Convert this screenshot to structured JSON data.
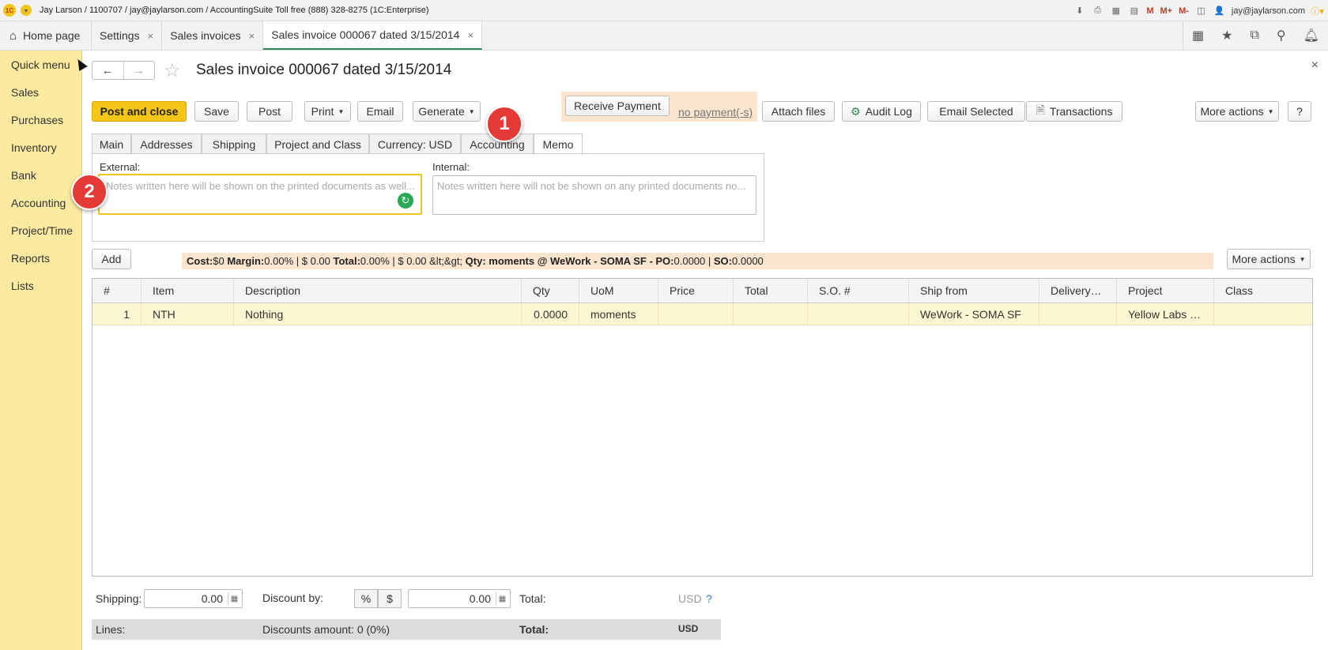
{
  "titlebar": {
    "text": "Jay Larson / 1100707 / jay@jaylarson.com / AccountingSuite Toll free (888) 328-8275   (1C:Enterprise)",
    "user": "jay@jaylarson.com",
    "m_labels": [
      "M",
      "M+",
      "M-"
    ]
  },
  "tabs": [
    {
      "label": "Home page"
    },
    {
      "label": "Settings"
    },
    {
      "label": "Sales invoices"
    },
    {
      "label": "Sales invoice 000067 dated 3/15/2014"
    }
  ],
  "sidebar": {
    "items": [
      "Quick menu",
      "Sales",
      "Purchases",
      "Inventory",
      "Bank",
      "Accounting",
      "Project/Time",
      "Reports",
      "Lists"
    ]
  },
  "document": {
    "title": "Sales invoice 000067 dated 3/15/2014"
  },
  "toolbar": {
    "post_close": "Post and close",
    "save": "Save",
    "post": "Post",
    "print": "Print",
    "email": "Email",
    "generate": "Generate",
    "receive_payment": "Receive Payment",
    "payments_link": "no payment(-s)",
    "attach": "Attach files",
    "audit": "Audit Log",
    "email_selected": "Email Selected",
    "transactions": "Transactions",
    "more_actions": "More actions",
    "help": "?"
  },
  "form_tabs": [
    "Main",
    "Addresses",
    "Shipping",
    "Project and Class",
    "Currency: USD",
    "Accounting",
    "Memo"
  ],
  "memo": {
    "external_label": "External:",
    "internal_label": "Internal:",
    "external_placeholder": "Notes written here will be shown on the printed documents as well...",
    "internal_placeholder": "Notes written here will not be shown on any printed documents no..."
  },
  "badges": [
    "1",
    "2"
  ],
  "lines": {
    "add": "Add",
    "more_actions": "More actions",
    "summary": {
      "cost_label": "Cost:",
      "cost": "$0",
      "margin_label": "Margin:",
      "margin": "0.00% | $ 0.00",
      "total_label": "Total:",
      "total": "0.00% | $ 0.00 &lt;&gt;",
      "qty_label": "Qty:",
      "qty": "moments @ WeWork - SOMA SF",
      "po_label": "- PO:",
      "po": "0.0000 |",
      "so_label": "SO:",
      "so": "0.0000"
    },
    "columns": [
      "#",
      "Item",
      "Description",
      "Qty",
      "UoM",
      "Price",
      "Total",
      "S.O. #",
      "Ship from",
      "Delivery…",
      "Project",
      "Class"
    ],
    "rows": [
      {
        "num": "1",
        "item": "NTH",
        "description": "Nothing",
        "qty": "0.0000",
        "uom": "moments",
        "price": "",
        "total": "",
        "so": "",
        "ship_from": "WeWork - SOMA SF",
        "delivery": "",
        "project": "Yellow Labs …",
        "class": ""
      }
    ]
  },
  "footer": {
    "shipping_label": "Shipping:",
    "shipping_value": "0.00",
    "discount_label": "Discount by:",
    "pct": "%",
    "dollar": "$",
    "discount_value": "0.00",
    "total_label": "Total:",
    "currency": "USD",
    "help": "?",
    "lines_label": "Lines:",
    "discounts_amount": "Discounts amount: 0   (0%)",
    "total_label2": "Total:",
    "currency2": "USD"
  },
  "colors": {
    "accent": "#f5c518",
    "sidebar_bg": "#fbeaa0",
    "summary_bg": "#fbe5cf",
    "badge": "#e53935",
    "active_tab_line": "#2e8b57"
  }
}
